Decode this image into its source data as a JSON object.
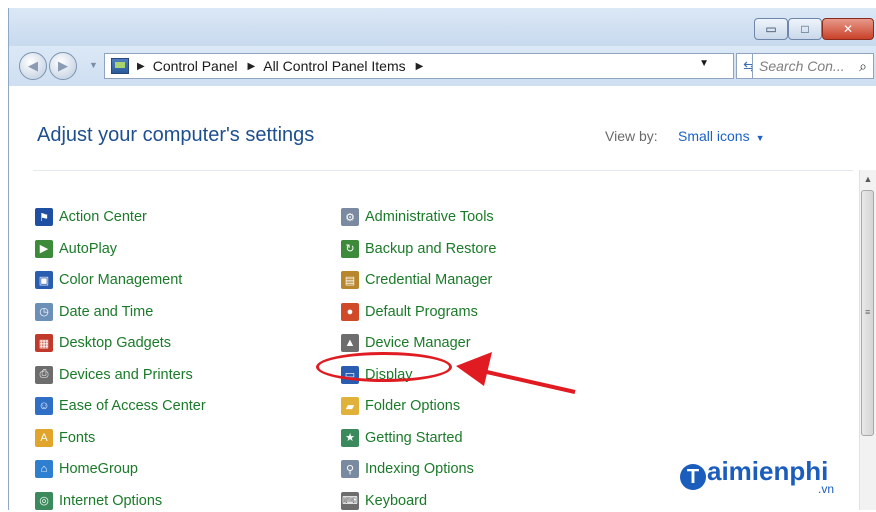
{
  "window": {
    "buttons": {
      "minimize": "▭",
      "maximize": "□",
      "close": "✕"
    }
  },
  "address": {
    "crumbs": [
      "Control Panel",
      "All Control Panel Items"
    ],
    "search_placeholder": "Search Con..."
  },
  "header": {
    "title": "Adjust your computer's settings",
    "view_by_label": "View by:",
    "view_by_value": "Small icons"
  },
  "items": {
    "left": [
      {
        "label": "Action Center",
        "icon": "flag-icon",
        "color": "#1f4fa3"
      },
      {
        "label": "AutoPlay",
        "icon": "autoplay-icon",
        "color": "#3d8a3a"
      },
      {
        "label": "Color Management",
        "icon": "monitor-color-icon",
        "color": "#2a5db0"
      },
      {
        "label": "Date and Time",
        "icon": "clock-icon",
        "color": "#6c8fb8"
      },
      {
        "label": "Desktop Gadgets",
        "icon": "gadgets-icon",
        "color": "#c0392b"
      },
      {
        "label": "Devices and Printers",
        "icon": "printer-icon",
        "color": "#6d6d6d"
      },
      {
        "label": "Ease of Access Center",
        "icon": "accessibility-icon",
        "color": "#2f6fc6"
      },
      {
        "label": "Fonts",
        "icon": "fonts-icon",
        "color": "#e0a52a"
      },
      {
        "label": "HomeGroup",
        "icon": "homegroup-icon",
        "color": "#2f7fd1"
      },
      {
        "label": "Internet Options",
        "icon": "internet-icon",
        "color": "#3b8a5e"
      }
    ],
    "right": [
      {
        "label": "Administrative Tools",
        "icon": "admin-tools-icon",
        "color": "#7a8aa0"
      },
      {
        "label": "Backup and Restore",
        "icon": "backup-icon",
        "color": "#3d8a3a"
      },
      {
        "label": "Credential Manager",
        "icon": "credential-icon",
        "color": "#b8862d"
      },
      {
        "label": "Default Programs",
        "icon": "default-programs-icon",
        "color": "#d04a2a"
      },
      {
        "label": "Device Manager",
        "icon": "device-manager-icon",
        "color": "#6d6d6d"
      },
      {
        "label": "Display",
        "icon": "display-icon",
        "color": "#2a5db0"
      },
      {
        "label": "Folder Options",
        "icon": "folder-icon",
        "color": "#e0b23a"
      },
      {
        "label": "Getting Started",
        "icon": "getting-started-icon",
        "color": "#3b8a5e"
      },
      {
        "label": "Indexing Options",
        "icon": "indexing-icon",
        "color": "#7a8aa0"
      },
      {
        "label": "Keyboard",
        "icon": "keyboard-icon",
        "color": "#6d6d6d"
      }
    ]
  },
  "colors": {
    "link": "#1b7a2a",
    "title": "#1e4f8f",
    "annotation": "#e11b22"
  },
  "watermark": {
    "text": "aimienphi",
    "logo": "T",
    "suffix": ".vn"
  }
}
